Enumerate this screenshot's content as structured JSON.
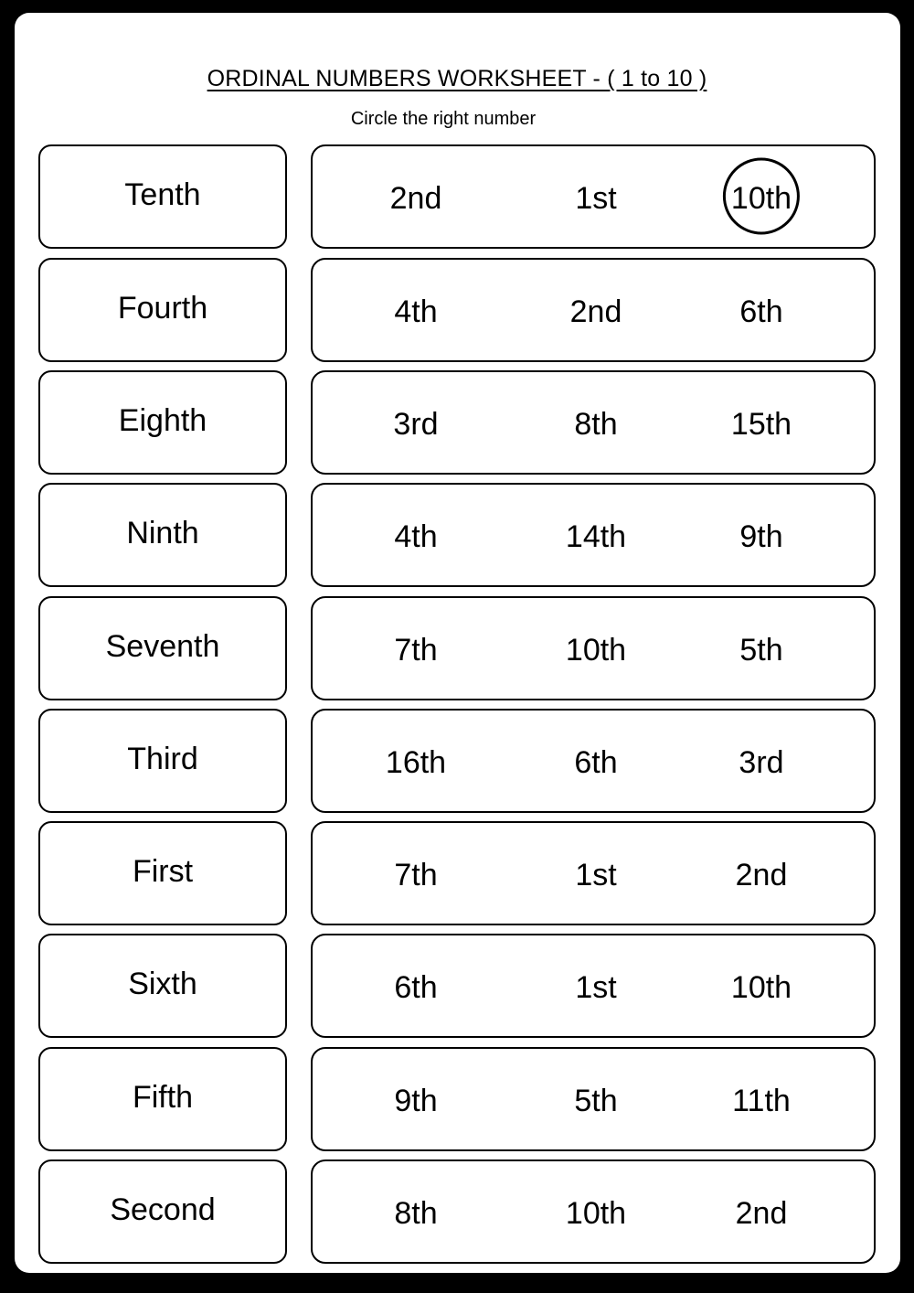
{
  "worksheet": {
    "title": "ORDINAL NUMBERS WORKSHEET - ( 1 to 10 )",
    "instruction": "Circle the right number",
    "rows": [
      {
        "word": "Tenth",
        "choices": [
          "2nd",
          "1st",
          "10th"
        ],
        "circled_index": 2
      },
      {
        "word": "Fourth",
        "choices": [
          "4th",
          "2nd",
          "6th"
        ],
        "circled_index": null
      },
      {
        "word": "Eighth",
        "choices": [
          "3rd",
          "8th",
          "15th"
        ],
        "circled_index": null
      },
      {
        "word": "Ninth",
        "choices": [
          "4th",
          "14th",
          "9th"
        ],
        "circled_index": null
      },
      {
        "word": "Seventh",
        "choices": [
          "7th",
          "10th",
          "5th"
        ],
        "circled_index": null
      },
      {
        "word": "Third",
        "choices": [
          "16th",
          "6th",
          "3rd"
        ],
        "circled_index": null
      },
      {
        "word": "First",
        "choices": [
          "7th",
          "1st",
          "2nd"
        ],
        "circled_index": null
      },
      {
        "word": "Sixth",
        "choices": [
          "6th",
          "1st",
          "10th"
        ],
        "circled_index": null
      },
      {
        "word": "Fifth",
        "choices": [
          "9th",
          "5th",
          "11th"
        ],
        "circled_index": null
      },
      {
        "word": "Second",
        "choices": [
          "8th",
          "10th",
          "2nd"
        ],
        "circled_index": null
      }
    ]
  }
}
